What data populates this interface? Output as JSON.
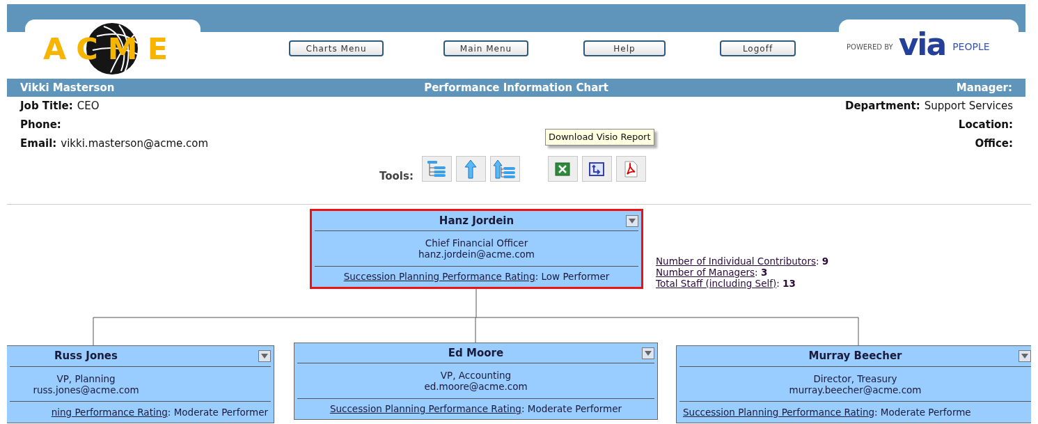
{
  "header": {
    "logo_text": "ACME",
    "nav_buttons": [
      "Charts Menu",
      "Main Menu",
      "Help",
      "Logoff"
    ],
    "powered_by": "POWERED BY",
    "brand": "via",
    "brand_suffix": "PEOPLE"
  },
  "title_bar": {
    "name": "Vikki Masterson",
    "title": "Performance Information Chart",
    "manager_label": "Manager:"
  },
  "info_left": [
    {
      "label": "Job Title:",
      "value": "CEO"
    },
    {
      "label": "Phone:"
    },
    {
      "label": "Email:",
      "value": "vikki.masterson@acme.com"
    }
  ],
  "info_right": [
    {
      "label": "Department:",
      "value": "Support Services"
    },
    {
      "label": "Location:"
    },
    {
      "label": "Office:"
    }
  ],
  "tools": {
    "label": "Tools:",
    "groups": [
      [
        {
          "kind": "org-tree"
        },
        {
          "kind": "up-level"
        },
        {
          "kind": "up-tree"
        }
      ],
      [
        {
          "kind": "excel"
        },
        {
          "kind": "visio"
        },
        {
          "kind": "pdf"
        }
      ]
    ]
  },
  "tooltip": "Download Visio Report",
  "nodes": [
    {
      "name": "Hanz Jordein",
      "title": "Chief Financial Officer",
      "email": "hanz.jordein@acme.com",
      "rating_label": "Succession Planning Performance Rating",
      "rating_value": ": Low Performer",
      "selected": true
    },
    {
      "name": "Russ Jones",
      "title": "VP, Planning",
      "email": "russ.jones@acme.com",
      "rating_label": "ning Performance Rating",
      "rating_value": ": Moderate Performer",
      "selected": false
    },
    {
      "name": "Ed Moore",
      "title": "VP, Accounting",
      "email": "ed.moore@acme.com",
      "rating_label": "Succession Planning Performance Rating",
      "rating_value": ": Moderate Performer",
      "selected": false
    },
    {
      "name": "Murray Beecher",
      "title": "Director, Treasury",
      "email": "murray.beecher@acme.com",
      "rating_label": "Succession Planning Performance Rating",
      "rating_value": ": Moderate Performe",
      "selected": false
    }
  ],
  "stats": [
    {
      "label": "Number of Individual Contributors",
      "rest": ": **9**"
    },
    {
      "label": "Number of Managers",
      "rest": ": **3**"
    },
    {
      "label": "Total Staff (including Self)",
      "rest": ": **13**"
    }
  ]
}
